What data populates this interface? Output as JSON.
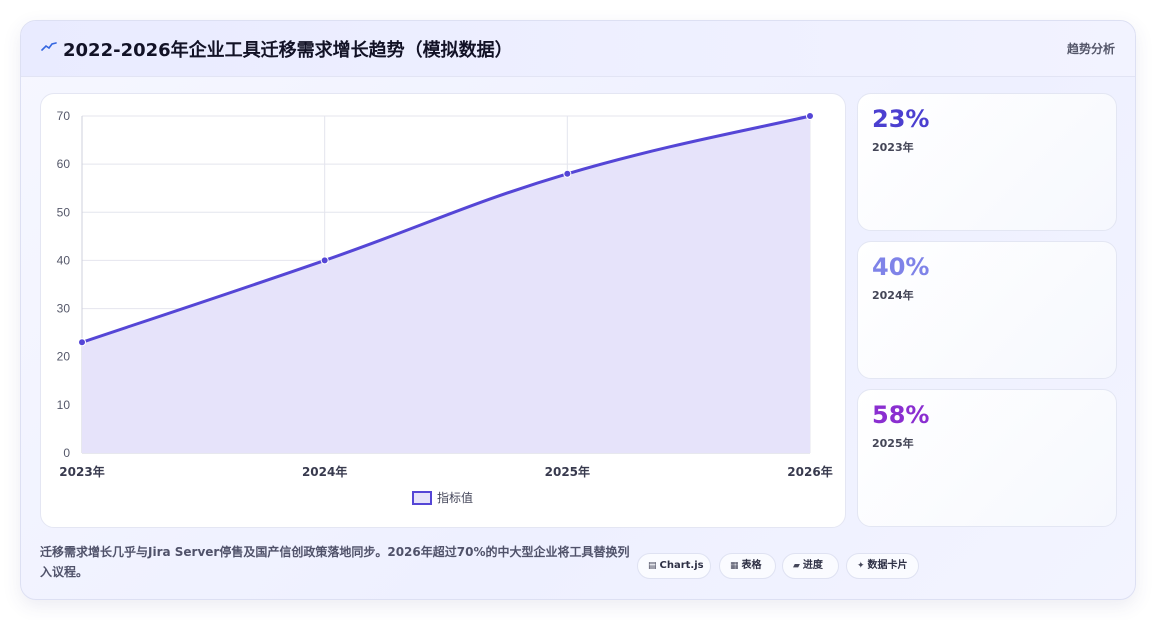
{
  "header": {
    "icon": "line-chart-icon",
    "title": "2022-2026年企业工具迁移需求增长趋势（模拟数据）",
    "tag": "趋势分析"
  },
  "chart_data": {
    "type": "area",
    "x": [
      "2023年",
      "2024年",
      "2025年",
      "2026年"
    ],
    "series": [
      {
        "name": "指标值",
        "values": [
          23,
          40,
          58,
          70
        ],
        "color": "#5546d6",
        "fill": "#e6e3fa"
      }
    ],
    "ylim": [
      0,
      70
    ],
    "yticks": [
      0,
      10,
      20,
      30,
      40,
      50,
      60,
      70
    ],
    "grid": true,
    "legend_position": "bottom"
  },
  "stats": [
    {
      "value": "23%",
      "label": "2023年",
      "color": "#4b3fd0"
    },
    {
      "value": "40%",
      "label": "2024年",
      "color": "#7f83e8"
    },
    {
      "value": "58%",
      "label": "2025年",
      "color": "#8a2ed0"
    }
  ],
  "footer": {
    "note": "迁移需求增长几乎与Jira Server停售及国产信创政策落地同步。2026年超过70%的中大型企业将工具替换列入议程。",
    "pills": [
      {
        "icon": "chart-icon",
        "glyph": "▤",
        "label": "Chart.js"
      },
      {
        "icon": "table-icon",
        "glyph": "▦",
        "label": "表格"
      },
      {
        "icon": "progress-icon",
        "glyph": "▰",
        "label": "进度"
      },
      {
        "icon": "sparkle-icon",
        "glyph": "✦",
        "label": "数据卡片"
      }
    ]
  }
}
